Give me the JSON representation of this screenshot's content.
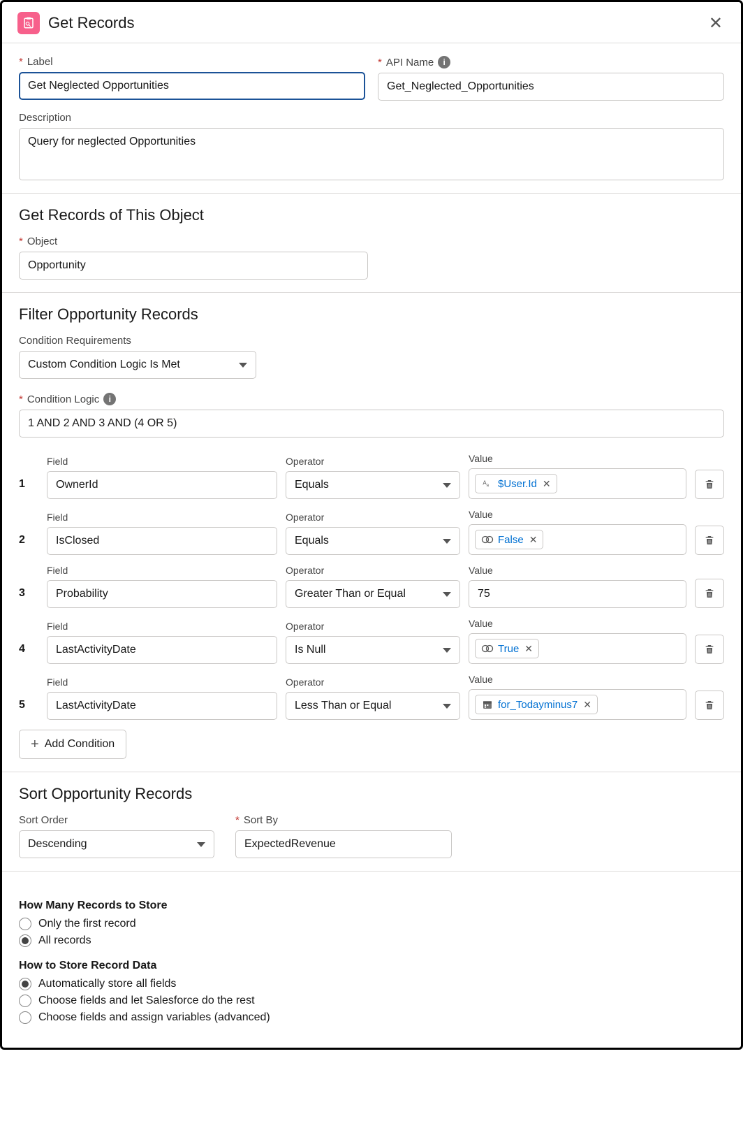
{
  "header": {
    "title": "Get Records"
  },
  "labels": {
    "label": "Label",
    "apiName": "API Name",
    "description": "Description",
    "object": "Object",
    "conditionReq": "Condition Requirements",
    "conditionLogic": "Condition Logic",
    "field": "Field",
    "operator": "Operator",
    "value": "Value",
    "addCondition": "Add Condition",
    "sortOrder": "Sort Order",
    "sortBy": "Sort By",
    "howMany": "How Many Records to Store",
    "howStore": "How to Store Record Data"
  },
  "fields": {
    "label": "Get Neglected Opportunities",
    "apiName": "Get_Neglected_Opportunities",
    "description": "Query for neglected Opportunities",
    "object": "Opportunity",
    "conditionReq": "Custom Condition Logic Is Met",
    "conditionLogic": "1 AND 2 AND 3 AND (4 OR 5)",
    "sortOrder": "Descending",
    "sortBy": "ExpectedRevenue"
  },
  "sections": {
    "object": "Get Records of This Object",
    "filter": "Filter Opportunity Records",
    "sort": "Sort Opportunity Records"
  },
  "conditions": [
    {
      "num": "1",
      "field": "OwnerId",
      "op": "Equals",
      "valueType": "pill",
      "valueIcon": "text",
      "value": "$User.Id"
    },
    {
      "num": "2",
      "field": "IsClosed",
      "op": "Equals",
      "valueType": "pill",
      "valueIcon": "boolean",
      "value": "False"
    },
    {
      "num": "3",
      "field": "Probability",
      "op": "Greater Than or Equal",
      "valueType": "text",
      "value": "75"
    },
    {
      "num": "4",
      "field": "LastActivityDate",
      "op": "Is Null",
      "valueType": "pill",
      "valueIcon": "boolean",
      "value": "True"
    },
    {
      "num": "5",
      "field": "LastActivityDate",
      "op": "Less Than or Equal",
      "valueType": "pill",
      "valueIcon": "date",
      "value": "for_Todayminus7"
    }
  ],
  "radioHowMany": [
    {
      "label": "Only the first record",
      "selected": false
    },
    {
      "label": "All records",
      "selected": true
    }
  ],
  "radioHowStore": [
    {
      "label": "Automatically store all fields",
      "selected": true
    },
    {
      "label": "Choose fields and let Salesforce do the rest",
      "selected": false
    },
    {
      "label": "Choose fields and assign variables (advanced)",
      "selected": false
    }
  ]
}
